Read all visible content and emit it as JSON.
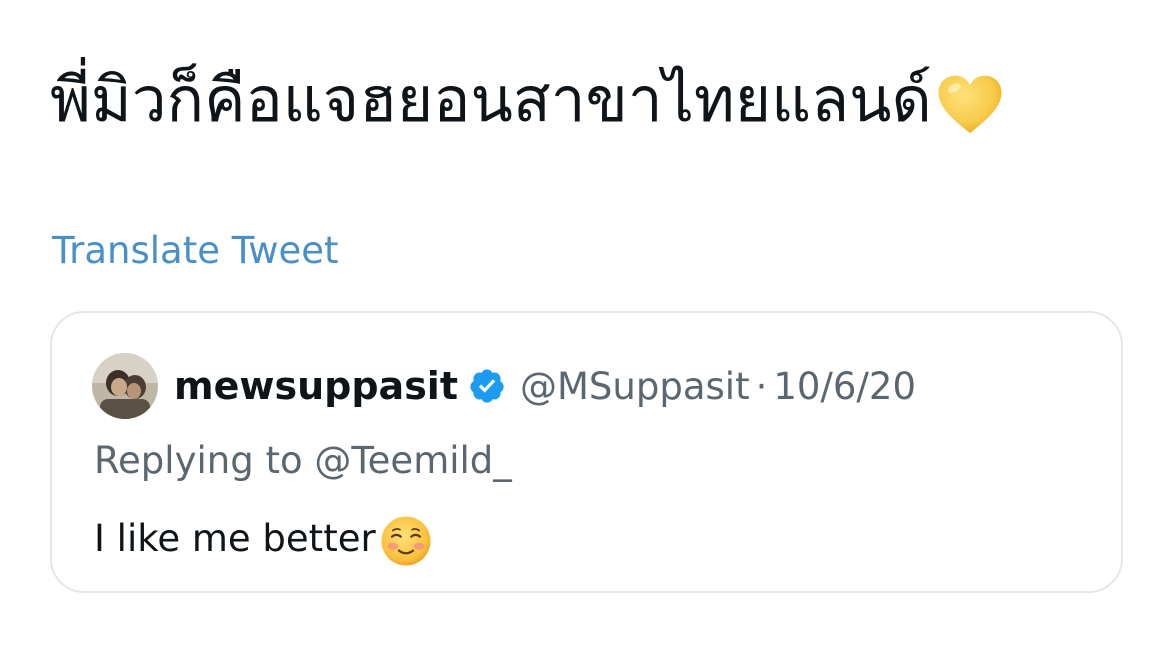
{
  "tweet": {
    "text": "พี่มิวก็คือแจฮยอนสาขาไทยแลนด์",
    "emoji_icon": "yellow-heart-icon",
    "translate_label": "Translate Tweet"
  },
  "quoted_tweet": {
    "avatar_icon": "profile-photo",
    "display_name": "mewsuppasit",
    "verified_icon": "verified-badge-icon",
    "handle": "@MSuppasit",
    "separator": "·",
    "date": "10/6/20",
    "replying_prefix": "Replying to ",
    "replying_to": "@Teemild_",
    "text": "I like me better",
    "emoji_icon": "smiling-face-icon"
  },
  "colors": {
    "link": "#4a90c8",
    "secondary_text": "#5b6770",
    "primary_text": "#0f1419",
    "verified_blue": "#1d9bf0",
    "card_border": "#e4e7ea",
    "heart_yellow": "#f7c948"
  }
}
